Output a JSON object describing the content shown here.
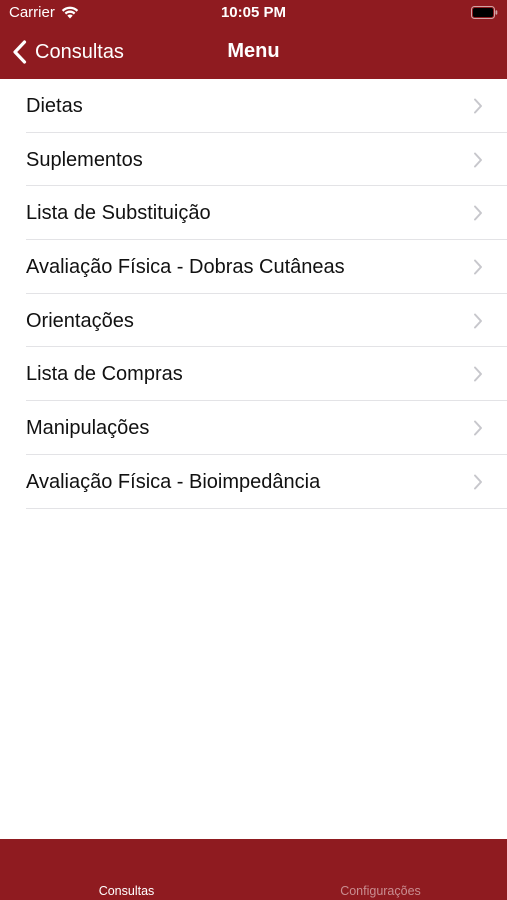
{
  "status_bar": {
    "carrier": "Carrier",
    "time": "10:05 PM",
    "wifi_icon": "wifi-icon",
    "battery_icon": "battery-full-icon"
  },
  "nav": {
    "back_label": "Consultas",
    "back_icon": "chevron-left-icon",
    "title": "Menu"
  },
  "menu": {
    "items": [
      {
        "label": "Dietas"
      },
      {
        "label": "Suplementos"
      },
      {
        "label": "Lista de Substituição"
      },
      {
        "label": "Avaliação Física - Dobras Cutâneas"
      },
      {
        "label": "Orientações"
      },
      {
        "label": "Lista de Compras"
      },
      {
        "label": "Manipulações"
      },
      {
        "label": "Avaliação Física - Bioimpedância"
      }
    ],
    "row_icon": "chevron-right-icon"
  },
  "tab_bar": {
    "tabs": [
      {
        "label": "Consultas",
        "selected": true
      },
      {
        "label": "Configurações",
        "selected": false
      }
    ]
  },
  "colors": {
    "brand": "#8f1b20",
    "background": "#ffffff",
    "separator": "#e3e3e6",
    "chevron": "#c7c7cc",
    "tab_inactive": "#c98d90"
  }
}
